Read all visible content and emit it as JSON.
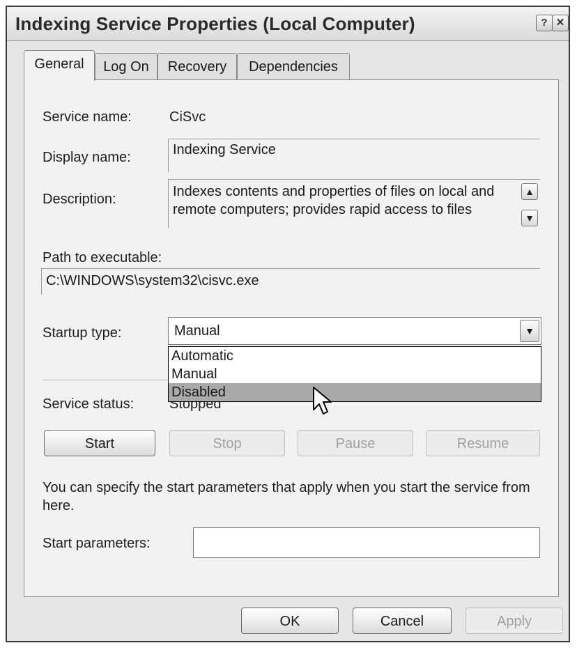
{
  "window": {
    "title": "Indexing Service Properties (Local Computer)",
    "help_label": "?",
    "close_label": "✕"
  },
  "tabs": [
    {
      "label": "General"
    },
    {
      "label": "Log On"
    },
    {
      "label": "Recovery"
    },
    {
      "label": "Dependencies"
    }
  ],
  "general": {
    "service_name_label": "Service name:",
    "service_name_value": "CiSvc",
    "display_name_label": "Display name:",
    "display_name_value": "Indexing Service",
    "description_label": "Description:",
    "description_line1": "Indexes contents and properties of files on local and",
    "description_line2": "remote computers; provides rapid access to files",
    "path_label": "Path to executable:",
    "path_value": "C:\\WINDOWS\\system32\\cisvc.exe",
    "startup_label": "Startup type:",
    "startup_value": "Manual",
    "startup_options": [
      "Automatic",
      "Manual",
      "Disabled"
    ],
    "startup_highlighted": "Disabled",
    "status_label": "Service status:",
    "status_value": "Stopped",
    "start_button": "Start",
    "stop_button": "Stop",
    "pause_button": "Pause",
    "resume_button": "Resume",
    "params_note": "You can specify the start parameters that apply when you start the service from here.",
    "params_label": "Start parameters:",
    "params_value": ""
  },
  "footer": {
    "ok": "OK",
    "cancel": "Cancel",
    "apply": "Apply"
  }
}
